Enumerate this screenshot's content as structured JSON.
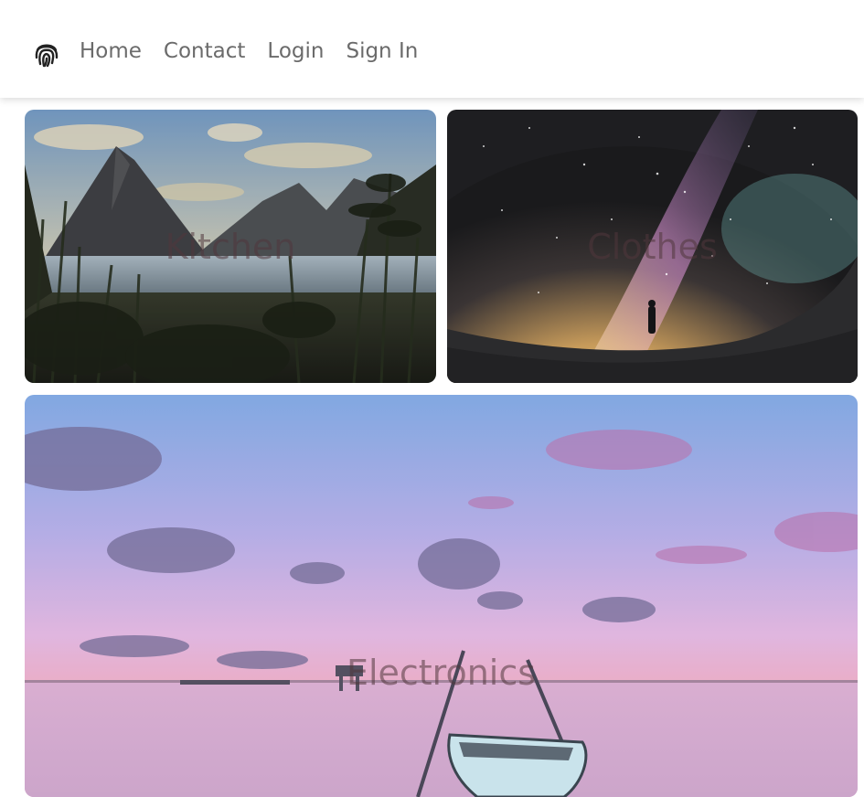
{
  "nav": {
    "brand_icon": "fingerprint-icon",
    "links": [
      {
        "label": "Home"
      },
      {
        "label": "Contact"
      },
      {
        "label": "Login"
      },
      {
        "label": "Sign In"
      }
    ]
  },
  "categories": [
    {
      "label": "Kitchen",
      "image": "mountain-lake-landscape"
    },
    {
      "label": "Clothes",
      "image": "milky-way-night-sky"
    },
    {
      "label": "Electronics",
      "image": "sunset-lake-boat"
    }
  ],
  "colors": {
    "nav_text": "#6b6b6b",
    "label_text": "#50373c"
  }
}
